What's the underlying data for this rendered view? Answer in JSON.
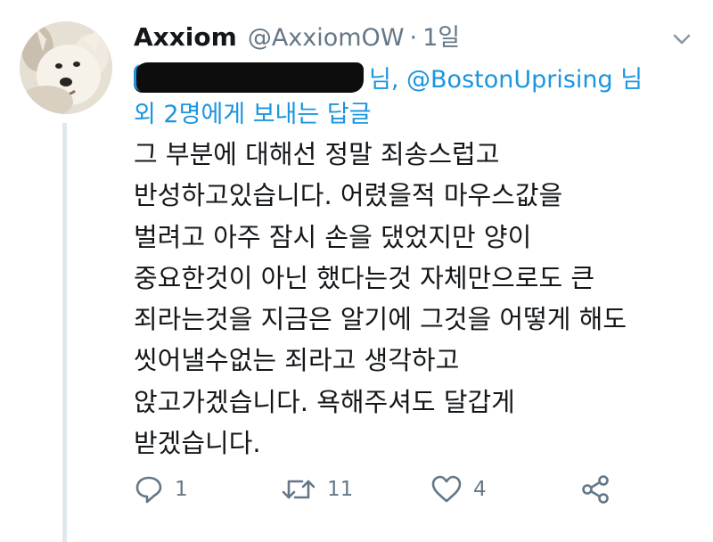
{
  "tweet": {
    "author_name": "Axxiom",
    "author_handle": "@AxxiomOW",
    "separator": "·",
    "time": "1일",
    "replying_to": {
      "redacted_suffix": "님,",
      "mention": "@BostonUprising",
      "mention_suffix": "님",
      "others": "외 2명",
      "trailing": "에게 보내는 답글"
    },
    "body_lines": [
      "그 부분에 대해선 정말 죄송스럽고",
      "반성하고있습니다. 어렸을적 마우스값을",
      "벌려고 아주 잠시 손을 댔었지만 양이",
      "중요한것이 아닌 했다는것 자체만으로도 큰",
      "죄라는것을 지금은 알기에 그것을 어떻게 해도",
      "씻어낼수없는 죄라고 생각하고",
      "앉고가겠습니다. 욕해주셔도 달갑게",
      "받겠습니다."
    ],
    "actions": {
      "reply_count": "1",
      "retweet_count": "11",
      "like_count": "4"
    }
  },
  "icons": [
    "chevron-down-icon",
    "reply-icon",
    "retweet-icon",
    "like-icon",
    "share-icon"
  ],
  "colors": {
    "link": "#1b95e0",
    "muted": "#657786",
    "text": "#14171a",
    "thread_line": "#e1e8ed"
  }
}
